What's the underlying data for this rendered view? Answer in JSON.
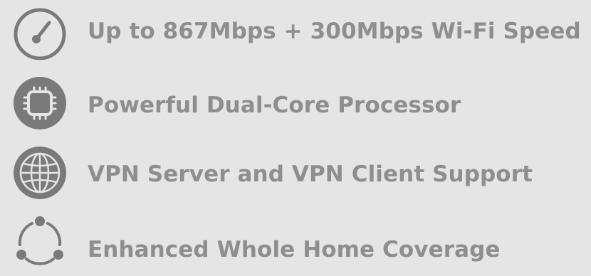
{
  "colors": {
    "background": "#e5e5e5",
    "icon": "#7a7a7a",
    "text": "#8e8e8e"
  },
  "features": [
    {
      "icon": "speedometer-icon",
      "label": "Up to 867Mbps + 300Mbps Wi-Fi Speed"
    },
    {
      "icon": "processor-chip-icon",
      "label": "Powerful Dual-Core Processor"
    },
    {
      "icon": "globe-icon",
      "label": "VPN Server and VPN Client Support"
    },
    {
      "icon": "network-nodes-icon",
      "label": "Enhanced Whole Home Coverage"
    }
  ]
}
